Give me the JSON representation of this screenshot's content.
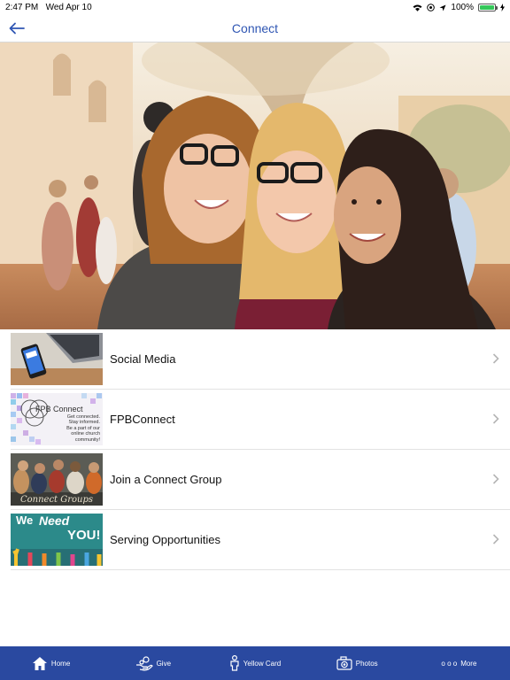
{
  "status_bar": {
    "time": "2:47 PM",
    "date": "Wed Apr 10",
    "battery": "100%"
  },
  "nav": {
    "title": "Connect",
    "back_icon": "arrow-left-icon"
  },
  "list": {
    "items": [
      {
        "label": "Social Media",
        "thumb_icon": "social-media-thumbnail"
      },
      {
        "label": "FPBConnect",
        "thumb_icon": "fpbconnect-thumbnail",
        "thumb_title": "FPB Connect",
        "thumb_lines": [
          "Get connected.",
          "Stay informed.",
          "Be a part of our",
          "online church",
          "community!"
        ]
      },
      {
        "label": "Join a Connect Group",
        "thumb_icon": "connect-groups-thumbnail",
        "thumb_caption": "Connect Groups"
      },
      {
        "label": "Serving Opportunities",
        "thumb_icon": "we-need-you-thumbnail",
        "thumb_we": "We",
        "thumb_need": "Need",
        "thumb_you": "YOU!"
      }
    ]
  },
  "tab_bar": {
    "items": [
      {
        "label": "Home",
        "icon": "home-icon"
      },
      {
        "label": "Give",
        "icon": "give-hand-icon"
      },
      {
        "label": "Yellow Card",
        "icon": "person-icon"
      },
      {
        "label": "Photos",
        "icon": "camera-icon"
      },
      {
        "label": "More",
        "icon": "more-dots-icon",
        "dots": "o o o"
      }
    ]
  },
  "colors": {
    "accent": "#2f56b3",
    "tab_bar": "#2a49a0",
    "battery": "#34c759"
  }
}
